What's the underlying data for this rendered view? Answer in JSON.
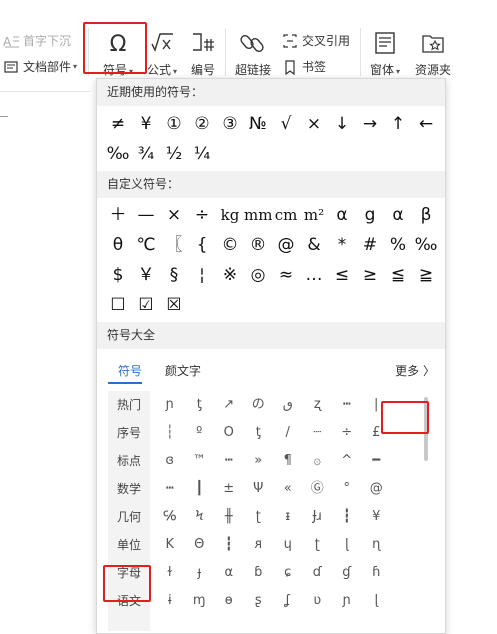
{
  "ribbon": {
    "first_indent": "首字下沉",
    "doc_parts": "文档部件",
    "symbol": "符号",
    "formula": "公式",
    "numbering": "编号",
    "hyperlink": "超链接",
    "cross_ref": "交叉引用",
    "bookmark": "书签",
    "form": "窗体",
    "resources": "资源夹"
  },
  "dropdown": {
    "recent_title": "近期使用的符号：",
    "recent": [
      "≠",
      "¥",
      "①",
      "②",
      "③",
      "№",
      "√",
      "×",
      "↓",
      "→",
      "↑",
      "←",
      "‰",
      "¾",
      "½",
      "¼"
    ],
    "custom_title": "自定义符号：",
    "custom": [
      "＋",
      "—",
      "×",
      "÷",
      "kg",
      "mm",
      "cm",
      "m²",
      "α",
      "g",
      "α",
      "β",
      "θ",
      "℃",
      "〖",
      "{",
      "©",
      "®",
      "@",
      "&",
      "*",
      "#",
      "%",
      "‰",
      "$",
      "￥",
      "§",
      "¦",
      "※",
      "◎",
      "≈",
      "…",
      "≤",
      "≥",
      "≦",
      "≧",
      "☐",
      "☑",
      "☒"
    ],
    "library_title": "符号大全",
    "tabs": [
      "符号",
      "颜文字"
    ],
    "more": "更多 〉",
    "categories": [
      "热门",
      "序号",
      "标点",
      "数学",
      "几何",
      "单位",
      "字母",
      "语文"
    ],
    "library": [
      "ɲ",
      "ƫ",
      "↗",
      "の",
      "ٯ",
      "ʐ",
      "┅",
      "|",
      "",
      "┆",
      "º",
      "Ο",
      "ƫ",
      "/",
      "┈",
      "÷",
      "£",
      "",
      "ɞ",
      "™",
      "┅",
      "»",
      "¶",
      "۞",
      "^",
      "━",
      "",
      "┅",
      "┃",
      "±",
      "Ψ",
      "«",
      "Ⓖ",
      "°",
      "@",
      "",
      "℅",
      "Ϟ",
      "╫",
      "ʈ",
      "ᵻ",
      "Ɉɹ",
      "┇",
      "¥",
      "",
      "Κ",
      "Θ",
      "┇",
      "ᴙ",
      "ɥ",
      "ʈ",
      "ɭ",
      "ɳ",
      "",
      "ɫ",
      "ɟ",
      "α",
      "ɓ",
      "ɕ",
      "ɗ",
      "ɠ",
      "ɦ",
      "",
      "ɨ",
      "ɱ",
      "ɵ",
      "ʂ",
      "ʆ",
      "ʋ",
      "ɲ",
      "ɭ",
      ""
    ]
  }
}
